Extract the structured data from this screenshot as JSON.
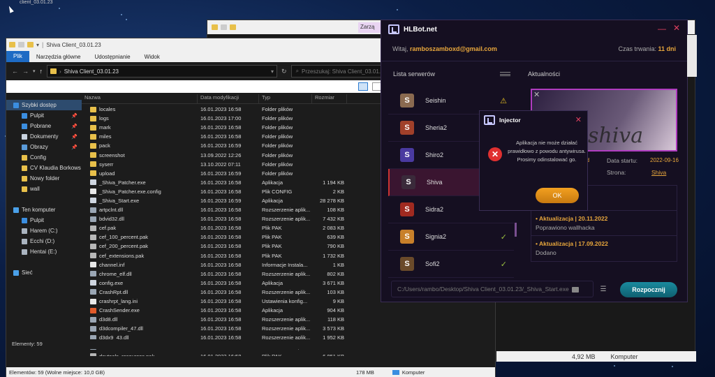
{
  "desktop": {
    "top_label": "client_03.01.23"
  },
  "back_window": {
    "tab_label": "Zarzą",
    "status_size": "4,92 MB",
    "status_computer": "Komputer"
  },
  "explorer": {
    "title": "Shiva Client_03.01.23",
    "ribbon": [
      "Plik",
      "Narzędzia główne",
      "Udostępnianie",
      "Widok"
    ],
    "address": "Shiva Client_03.01.23",
    "search_placeholder": "Przeszukaj: Shiva Client_03.01.23",
    "sidebar": [
      {
        "label": "Szybki dostęp",
        "color": "#3b8ee0",
        "sub": false,
        "pin": false,
        "sel": true
      },
      {
        "label": "Pulpit",
        "color": "#3b8ee0",
        "sub": true,
        "pin": true,
        "sel": false
      },
      {
        "label": "Pobrane",
        "color": "#3b8ee0",
        "sub": true,
        "pin": true,
        "sel": false
      },
      {
        "label": "Dokumenty",
        "color": "#c9d3e0",
        "sub": true,
        "pin": true,
        "sel": false
      },
      {
        "label": "Obrazy",
        "color": "#5a9ad8",
        "sub": true,
        "pin": true,
        "sel": false
      },
      {
        "label": "Config",
        "color": "#e8c04a",
        "sub": true,
        "pin": false,
        "sel": false
      },
      {
        "label": "CV Klaudia Borkows",
        "color": "#e8c04a",
        "sub": true,
        "pin": false,
        "sel": false
      },
      {
        "label": "Nowy folder",
        "color": "#e8c04a",
        "sub": true,
        "pin": false,
        "sel": false
      },
      {
        "label": "wall",
        "color": "#e8c04a",
        "sub": true,
        "pin": false,
        "sel": false
      },
      {
        "label": "",
        "color": "transparent",
        "sub": false,
        "pin": false,
        "sel": false
      },
      {
        "label": "Ten komputer",
        "color": "#4aa0e8",
        "sub": false,
        "pin": false,
        "sel": false
      },
      {
        "label": "Pulpit",
        "color": "#3b8ee0",
        "sub": true,
        "pin": false,
        "sel": false
      },
      {
        "label": "Harem (C:)",
        "color": "#aab4c0",
        "sub": true,
        "pin": false,
        "sel": false
      },
      {
        "label": "Ecchi (D:)",
        "color": "#aab4c0",
        "sub": true,
        "pin": false,
        "sel": false
      },
      {
        "label": "Hentai (E:)",
        "color": "#aab4c0",
        "sub": true,
        "pin": false,
        "sel": false
      },
      {
        "label": "",
        "color": "transparent",
        "sub": false,
        "pin": false,
        "sel": false
      },
      {
        "label": "Sieć",
        "color": "#4aa0e8",
        "sub": false,
        "pin": false,
        "sel": false
      }
    ],
    "columns": [
      "Nazwa",
      "Data modyfikacji",
      "Typ",
      "Rozmiar"
    ],
    "files": [
      {
        "name": "locales",
        "date": "16.01.2023 16:58",
        "type": "Folder plików",
        "size": "",
        "icon": "folder"
      },
      {
        "name": "logs",
        "date": "16.01.2023 17:00",
        "type": "Folder plików",
        "size": "",
        "icon": "folder"
      },
      {
        "name": "mark",
        "date": "16.01.2023 16:58",
        "type": "Folder plików",
        "size": "",
        "icon": "folder"
      },
      {
        "name": "miles",
        "date": "16.01.2023 16:58",
        "type": "Folder plików",
        "size": "",
        "icon": "folder"
      },
      {
        "name": "pack",
        "date": "16.01.2023 16:59",
        "type": "Folder plików",
        "size": "",
        "icon": "folder"
      },
      {
        "name": "screenshot",
        "date": "13.09.2022 12:26",
        "type": "Folder plików",
        "size": "",
        "icon": "folder"
      },
      {
        "name": "syserr",
        "date": "13.10.2022 07:11",
        "type": "Folder plików",
        "size": "",
        "icon": "folder"
      },
      {
        "name": "upload",
        "date": "16.01.2023 16:59",
        "type": "Folder plików",
        "size": "",
        "icon": "folder"
      },
      {
        "name": "_Shiva_Patcher.exe",
        "date": "16.01.2023 16:58",
        "type": "Aplikacja",
        "size": "1 194 KB",
        "icon": "exe"
      },
      {
        "name": "_Shiva_Patcher.exe.config",
        "date": "16.01.2023 16:58",
        "type": "Plik CONFIG",
        "size": "2 KB",
        "icon": "cfg"
      },
      {
        "name": "_Shiva_Start.exe",
        "date": "16.01.2023 16:59",
        "type": "Aplikacja",
        "size": "28 278 KB",
        "icon": "exe"
      },
      {
        "name": "artpclnt.dll",
        "date": "16.01.2023 16:58",
        "type": "Rozszerzenie aplik...",
        "size": "108 KB",
        "icon": "dll"
      },
      {
        "name": "bdvid32.dll",
        "date": "16.01.2023 16:58",
        "type": "Rozszerzenie aplik...",
        "size": "7 432 KB",
        "icon": "dll"
      },
      {
        "name": "cef.pak",
        "date": "16.01.2023 16:58",
        "type": "Plik PAK",
        "size": "2 083 KB",
        "icon": "pak"
      },
      {
        "name": "cef_100_percent.pak",
        "date": "16.01.2023 16:58",
        "type": "Plik PAK",
        "size": "639 KB",
        "icon": "pak"
      },
      {
        "name": "cef_200_percent.pak",
        "date": "16.01.2023 16:58",
        "type": "Plik PAK",
        "size": "790 KB",
        "icon": "pak"
      },
      {
        "name": "cef_extensions.pak",
        "date": "16.01.2023 16:58",
        "type": "Plik PAK",
        "size": "1 732 KB",
        "icon": "pak"
      },
      {
        "name": "channel.inf",
        "date": "16.01.2023 16:58",
        "type": "Informacje Instala...",
        "size": "1 KB",
        "icon": "cfg"
      },
      {
        "name": "chrome_elf.dll",
        "date": "16.01.2023 16:58",
        "type": "Rozszerzenie aplik...",
        "size": "802 KB",
        "icon": "dll"
      },
      {
        "name": "config.exe",
        "date": "16.01.2023 16:58",
        "type": "Aplikacja",
        "size": "3 671 KB",
        "icon": "exe"
      },
      {
        "name": "CrashRpt.dll",
        "date": "16.01.2023 16:58",
        "type": "Rozszerzenie aplik...",
        "size": "103 KB",
        "icon": "dll"
      },
      {
        "name": "crashrpt_lang.ini",
        "date": "16.01.2023 16:58",
        "type": "Ustawienia konfig...",
        "size": "9 KB",
        "icon": "cfg"
      },
      {
        "name": "CrashSender.exe",
        "date": "16.01.2023 16:58",
        "type": "Aplikacja",
        "size": "904 KB",
        "icon": "crash"
      },
      {
        "name": "d3d8.dll",
        "date": "16.01.2023 16:58",
        "type": "Rozszerzenie aplik...",
        "size": "118 KB",
        "icon": "dll"
      },
      {
        "name": "d3dcompiler_47.dll",
        "date": "16.01.2023 16:58",
        "type": "Rozszerzenie aplik...",
        "size": "3 573 KB",
        "icon": "dll"
      },
      {
        "name": "d3dx9_43.dll",
        "date": "16.01.2023 16:58",
        "type": "Rozszerzenie aplik...",
        "size": "1 952 KB",
        "icon": "dll"
      },
      {
        "name": "devil.dll",
        "date": "16.01.2023 16:58",
        "type": "Rozszerzenie aplik...",
        "size": "263 KB",
        "icon": "dll"
      },
      {
        "name": "devtools_resources.pak",
        "date": "16.01.2023 16:58",
        "type": "Plik PAK",
        "size": "6 851 KB",
        "icon": "pak"
      }
    ],
    "status_elements": "Elementy: 59",
    "status_bottom": "Elementów: 59 (Wolne miejsce: 10,0 GB)",
    "status_bottom_size": "178 MB",
    "status_bottom_computer": "Komputer"
  },
  "hlbot": {
    "title": "HLBot.net",
    "welcome_prefix": "Witaj, ",
    "email": "ramboszamboxd@gmail.com",
    "duration_label": "Czas trwania: ",
    "duration_value": "11 dni",
    "servers_title": "Lista serwerów",
    "servers": [
      {
        "name": "Seishin",
        "letter": "S",
        "bg": "#8a6a50",
        "status": "⚠",
        "status_color": "#e8c020",
        "active": false
      },
      {
        "name": "Sheria2",
        "letter": "S",
        "bg": "#a0402a",
        "status": "",
        "status_color": "",
        "active": false
      },
      {
        "name": "Shiro2",
        "letter": "S",
        "bg": "#4a3aa0",
        "status": "",
        "status_color": "",
        "active": false
      },
      {
        "name": "Shiva",
        "letter": "S",
        "bg": "#3a2a3a",
        "status": "",
        "status_color": "",
        "active": true
      },
      {
        "name": "Sidra2",
        "letter": "S",
        "bg": "#a02a20",
        "status": "",
        "status_color": "",
        "active": false
      },
      {
        "name": "Signia2",
        "letter": "S",
        "bg": "#c8802a",
        "status": "✓",
        "status_color": "#9ac040",
        "active": false
      },
      {
        "name": "Sofi2",
        "letter": "S",
        "bg": "#6a4a2a",
        "status": "✓",
        "status_color": "#9ac040",
        "active": false
      }
    ],
    "news_title": "Aktualności",
    "banner_text": "shiva",
    "server_info": {
      "visible_fragment": "rd",
      "start_label": "Data startu:",
      "start_value": "2022-09-16",
      "page_label": "Strona:",
      "page_value": "Shiva"
    },
    "news": [
      {
        "head": "12.12.2022",
        "body": ""
      },
      {
        "head": "• Aktualizacja | 20.11.2022",
        "body": "Poprawiono wallhacka"
      },
      {
        "head": "• Aktualizacja | 17.09.2022",
        "body": "Dodano"
      }
    ],
    "path": "C:/Users/rambo/Desktop/Shiva Client_03.01.23/_Shiva_Start.exe",
    "start_button": "Rozpocznij"
  },
  "injector": {
    "title": "Injector",
    "message": "Aplikacja nie może działać prawidłowo z powodu antywirusa. Prosimy odinstalować go.",
    "ok_label": "OK"
  }
}
